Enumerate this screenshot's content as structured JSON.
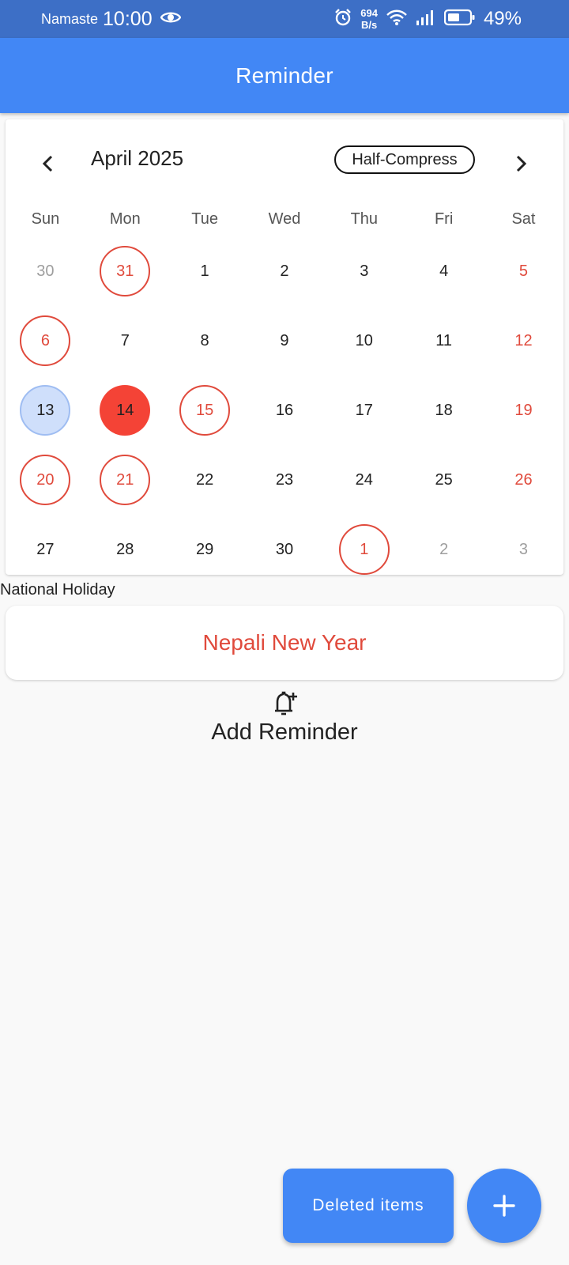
{
  "status_bar": {
    "carrier": "Namaste",
    "time": "10:00",
    "net_speed_value": "694",
    "net_speed_unit": "B/s",
    "battery": "49%"
  },
  "app_bar": {
    "title": "Reminder"
  },
  "calendar": {
    "month_title": "April 2025",
    "format_button": "Half-Compress",
    "weekdays": [
      "Sun",
      "Mon",
      "Tue",
      "Wed",
      "Thu",
      "Fri",
      "Sat"
    ],
    "weeks": [
      [
        {
          "label": "30",
          "style": "outside"
        },
        {
          "label": "31",
          "style": "ring"
        },
        {
          "label": "1",
          "style": "normal"
        },
        {
          "label": "2",
          "style": "normal"
        },
        {
          "label": "3",
          "style": "normal"
        },
        {
          "label": "4",
          "style": "normal"
        },
        {
          "label": "5",
          "style": "holiday"
        }
      ],
      [
        {
          "label": "6",
          "style": "ring"
        },
        {
          "label": "7",
          "style": "normal"
        },
        {
          "label": "8",
          "style": "normal"
        },
        {
          "label": "9",
          "style": "normal"
        },
        {
          "label": "10",
          "style": "normal"
        },
        {
          "label": "11",
          "style": "normal"
        },
        {
          "label": "12",
          "style": "holiday"
        }
      ],
      [
        {
          "label": "13",
          "style": "today"
        },
        {
          "label": "14",
          "style": "selected"
        },
        {
          "label": "15",
          "style": "ring"
        },
        {
          "label": "16",
          "style": "normal"
        },
        {
          "label": "17",
          "style": "normal"
        },
        {
          "label": "18",
          "style": "normal"
        },
        {
          "label": "19",
          "style": "holiday"
        }
      ],
      [
        {
          "label": "20",
          "style": "ring"
        },
        {
          "label": "21",
          "style": "ring"
        },
        {
          "label": "22",
          "style": "normal"
        },
        {
          "label": "23",
          "style": "normal"
        },
        {
          "label": "24",
          "style": "normal"
        },
        {
          "label": "25",
          "style": "normal"
        },
        {
          "label": "26",
          "style": "holiday"
        }
      ],
      [
        {
          "label": "27",
          "style": "normal"
        },
        {
          "label": "28",
          "style": "normal"
        },
        {
          "label": "29",
          "style": "normal"
        },
        {
          "label": "30",
          "style": "normal"
        },
        {
          "label": "1",
          "style": "ring"
        },
        {
          "label": "2",
          "style": "outside"
        },
        {
          "label": "3",
          "style": "outside"
        }
      ]
    ]
  },
  "holiday_section": {
    "label": "National Holiday",
    "name": "Nepali New Year"
  },
  "add_reminder": {
    "label": "Add Reminder",
    "icon": "bell-plus-icon"
  },
  "deleted_button": {
    "label": "Deleted items"
  },
  "fab": {
    "icon": "plus-icon"
  },
  "colors": {
    "primary": "#4287f5",
    "status_bar": "#3d6fc6",
    "holiday_red": "#e04a3c",
    "selected_red": "#f44336",
    "today_blue": "#cfdffb"
  }
}
